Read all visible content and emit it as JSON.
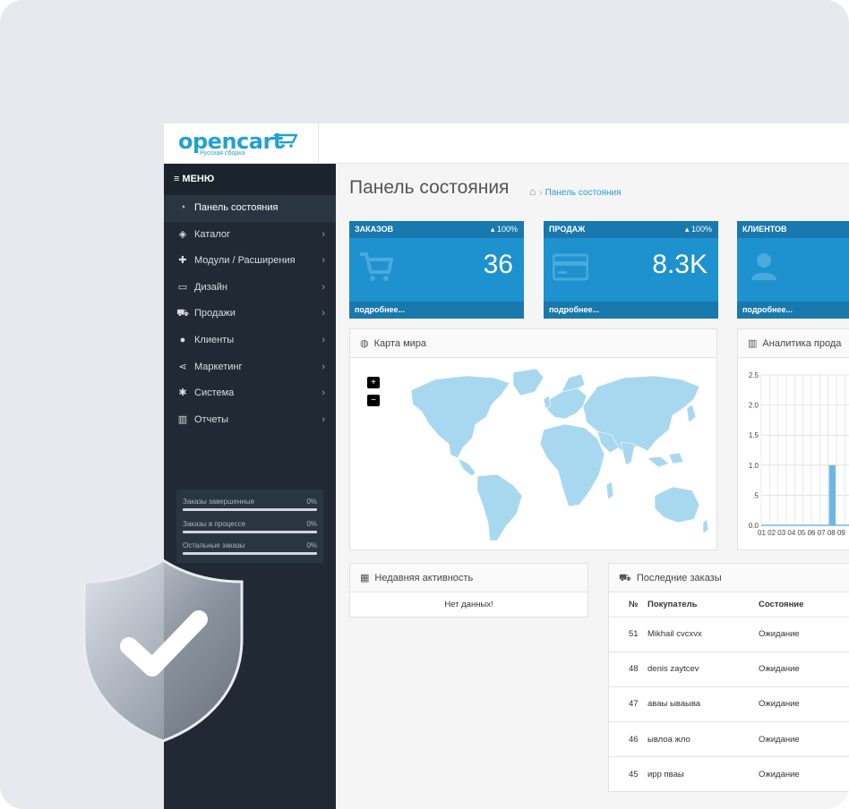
{
  "logo": {
    "text": "opencart",
    "sub": "Русская сборка"
  },
  "sidebar": {
    "menu_title": "МЕНЮ",
    "items": [
      {
        "label": "Панель состояния",
        "icon": "dashboard-icon",
        "active": true
      },
      {
        "label": "Каталог",
        "icon": "tag-icon"
      },
      {
        "label": "Модули / Расширения",
        "icon": "puzzle-icon"
      },
      {
        "label": "Дизайн",
        "icon": "monitor-icon"
      },
      {
        "label": "Продажи",
        "icon": "cart-icon"
      },
      {
        "label": "Клиенты",
        "icon": "user-icon"
      },
      {
        "label": "Маркетинг",
        "icon": "share-icon"
      },
      {
        "label": "Система",
        "icon": "gear-icon"
      },
      {
        "label": "Отчеты",
        "icon": "bar-chart-icon"
      }
    ],
    "stats": [
      {
        "label": "Заказы завершенные",
        "value": "0%",
        "progress": 0
      },
      {
        "label": "Заказы в процессе",
        "value": "0%",
        "progress": 0
      },
      {
        "label": "Остальные заказы",
        "value": "0%",
        "progress": 0
      }
    ]
  },
  "header": {
    "title": "Панель состояния",
    "breadcrumb": "Панель состояния"
  },
  "tiles": [
    {
      "title": "ЗАКАЗОВ",
      "percent": "100%",
      "value": "36",
      "link": "подробнее...",
      "icon": "cart-icon"
    },
    {
      "title": "ПРОДАЖ",
      "percent": "100%",
      "value": "8.3K",
      "link": "подробнее...",
      "icon": "credit-card-icon"
    },
    {
      "title": "КЛИЕНТОВ",
      "percent": "",
      "value": "",
      "link": "подробнее...",
      "icon": "user-icon"
    }
  ],
  "map_panel": {
    "title": "Карта мира",
    "zoom_in": "+",
    "zoom_out": "−"
  },
  "analytics_panel": {
    "title": "Аналитика прода",
    "y_ticks": [
      "2.5",
      "2.0",
      "1.5",
      "1.0",
      ".5",
      "0.0"
    ],
    "x_ticks": "01 02 03 04 05 06 07 08 09"
  },
  "chart_data": {
    "type": "bar",
    "categories": [
      "01",
      "02",
      "03",
      "04",
      "05",
      "06",
      "07",
      "08",
      "09"
    ],
    "values": [
      0,
      0,
      0,
      0,
      0,
      0,
      0,
      0,
      1.0
    ],
    "ylim": [
      0,
      2.5
    ],
    "grid": true
  },
  "activity_panel": {
    "title": "Недавняя активность",
    "empty": "Нет данных!"
  },
  "orders_panel": {
    "title": "Последние заказы",
    "columns": [
      "№",
      "Покупатель",
      "Состояние"
    ],
    "rows": [
      {
        "id": "51",
        "customer": "Mikhail cvcxvx",
        "status": "Ожидание"
      },
      {
        "id": "48",
        "customer": "denis zaytcev",
        "status": "Ожидание"
      },
      {
        "id": "47",
        "customer": "аваы ываыва",
        "status": "Ожидание"
      },
      {
        "id": "46",
        "customer": "ывлоа жло",
        "status": "Ожидание"
      },
      {
        "id": "45",
        "customer": "ирр пваы",
        "status": "Ожидание"
      }
    ]
  },
  "colors": {
    "accent": "#1e91cf",
    "sidebar": "#212a34",
    "map_land": "#a8d8f0"
  },
  "overlay": {
    "icon": "shield-check-icon"
  }
}
